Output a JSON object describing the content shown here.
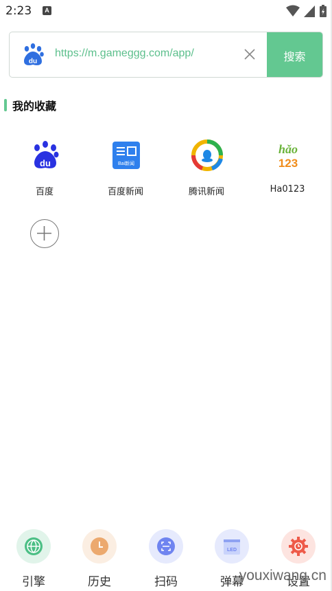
{
  "status_bar": {
    "time": "2:23",
    "notification_icon": "a-icon",
    "icons": [
      "wifi-icon",
      "signal-icon",
      "battery-icon"
    ]
  },
  "search": {
    "url": "https://m.gameggg.com/app/",
    "button_label": "搜索",
    "logo": "baidu-paw-icon",
    "clear_icon": "close-icon"
  },
  "favorites": {
    "title": "我的收藏",
    "items": [
      {
        "label": "百度",
        "icon": "baidu-icon"
      },
      {
        "label": "百度新闻",
        "icon": "baidu-news-icon"
      },
      {
        "label": "腾讯新闻",
        "icon": "tencent-news-icon"
      },
      {
        "label": "Ha0123",
        "icon": "hao123-icon"
      }
    ],
    "add_icon": "plus-icon"
  },
  "bottom_nav": {
    "items": [
      {
        "label": "引擎",
        "icon": "globe-icon",
        "color": "#4cbf85"
      },
      {
        "label": "历史",
        "icon": "clock-icon",
        "color": "#eca96e"
      },
      {
        "label": "扫码",
        "icon": "scan-icon",
        "color": "#6f84f0"
      },
      {
        "label": "弹幕",
        "icon": "led-icon",
        "color": "#8ea2f2"
      },
      {
        "label": "设置",
        "icon": "settings-icon",
        "color": "#ee5a49"
      }
    ]
  },
  "watermark": "youxiwang.cn",
  "colors": {
    "accent": "#63c891",
    "url_text": "#5cbf8c"
  }
}
